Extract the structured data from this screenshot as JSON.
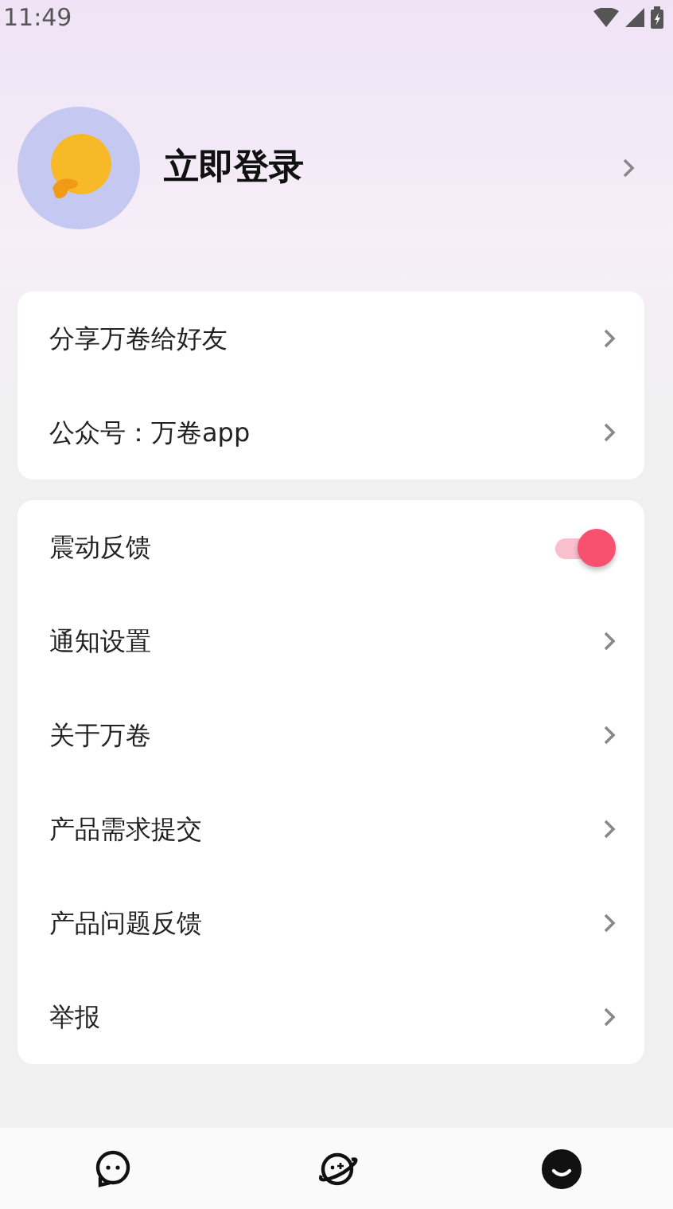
{
  "status_bar": {
    "time": "11:49"
  },
  "profile": {
    "login_label": "立即登录"
  },
  "groups": [
    {
      "items": [
        {
          "kind": "link",
          "label": "分享万卷给好友"
        },
        {
          "kind": "link",
          "label": "公众号：万卷app"
        }
      ]
    },
    {
      "items": [
        {
          "kind": "toggle",
          "label": "震动反馈",
          "on": true
        },
        {
          "kind": "link",
          "label": "通知设置"
        },
        {
          "kind": "link",
          "label": "关于万卷"
        },
        {
          "kind": "link",
          "label": "产品需求提交"
        },
        {
          "kind": "link",
          "label": "产品问题反馈"
        },
        {
          "kind": "link",
          "label": "举报"
        }
      ]
    }
  ],
  "bottom_nav": [
    {
      "kind": "chat",
      "selected": false
    },
    {
      "kind": "planet",
      "selected": false
    },
    {
      "kind": "smile",
      "selected": true
    }
  ]
}
